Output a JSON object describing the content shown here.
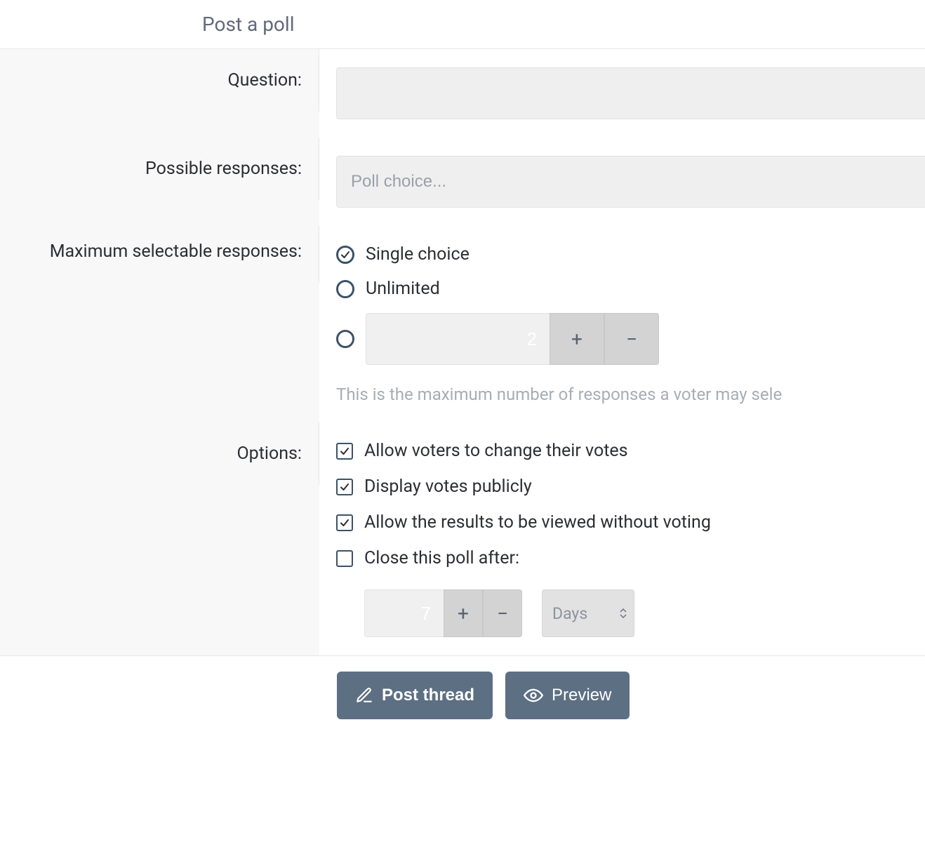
{
  "header": {
    "title": "Post a poll"
  },
  "form": {
    "question": {
      "label": "Question:",
      "value": ""
    },
    "responses": {
      "label": "Possible responses:",
      "placeholder": "Poll choice...",
      "value": ""
    },
    "max_select": {
      "label": "Maximum selectable responses:",
      "radios": {
        "single": "Single choice",
        "unlimited": "Unlimited"
      },
      "number_value": "2",
      "helper": "This is the maximum number of responses a voter may sele"
    },
    "options": {
      "label": "Options:",
      "change_vote": "Allow voters to change their votes",
      "display_public": "Display votes publicly",
      "view_without_vote": "Allow the results to be viewed without voting",
      "close_after": "Close this poll after:",
      "close_value": "7",
      "close_unit": "Days"
    }
  },
  "buttons": {
    "post": "Post thread",
    "preview": "Preview"
  },
  "glyphs": {
    "plus": "+",
    "minus": "−"
  }
}
